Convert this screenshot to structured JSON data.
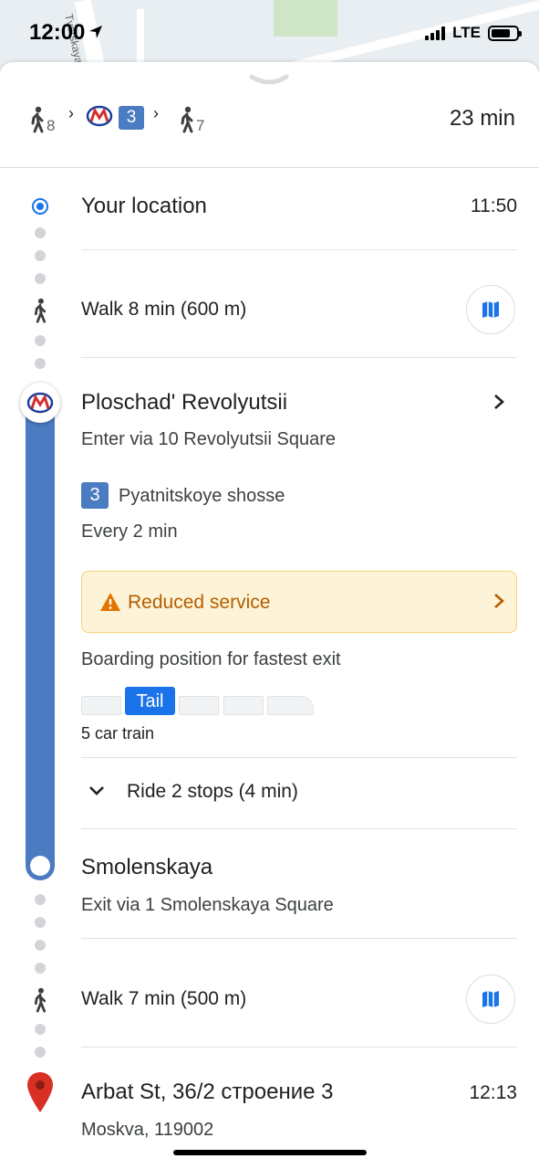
{
  "status_bar": {
    "time": "12:00",
    "network": "LTE"
  },
  "map": {
    "street_label": "Tverskaya"
  },
  "summary": {
    "walk_start_min": "8",
    "metro_line": "3",
    "walk_end_min": "7",
    "total_time": "23 min"
  },
  "origin": {
    "label": "Your location",
    "time": "11:50"
  },
  "walk1": {
    "label": "Walk 8 min (600 m)"
  },
  "station_start": {
    "name": "Ploschad' Revolyutsii",
    "entrance": "Enter via 10 Revolyutsii Square",
    "line_number": "3",
    "line_name": "Pyatnitskoye shosse",
    "frequency": "Every 2 min",
    "alert": "Reduced service",
    "boarding_title": "Boarding position for fastest exit",
    "boarding_position": "Tail",
    "train_info": "5 car train",
    "ride": "Ride 2 stops (4 min)"
  },
  "station_end": {
    "name": "Smolenskaya",
    "exit": "Exit via 1 Smolenskaya Square"
  },
  "walk2": {
    "label": "Walk 7 min (500 m)"
  },
  "destination": {
    "address": "Arbat St, 36/2 строение 3",
    "time": "12:13",
    "city": "Moskva, 119002"
  },
  "colors": {
    "metro_line": "#4b7bc0",
    "alert_bg": "#fdf4d8",
    "alert_text": "#b55d00",
    "accent": "#1a73e8",
    "pin": "#d93025"
  },
  "icons": [
    "location-arrow-icon",
    "walk-icon",
    "metro-logo-icon",
    "chevron-right-icon",
    "map-icon",
    "warning-icon",
    "chevron-down-icon",
    "pin-icon"
  ]
}
